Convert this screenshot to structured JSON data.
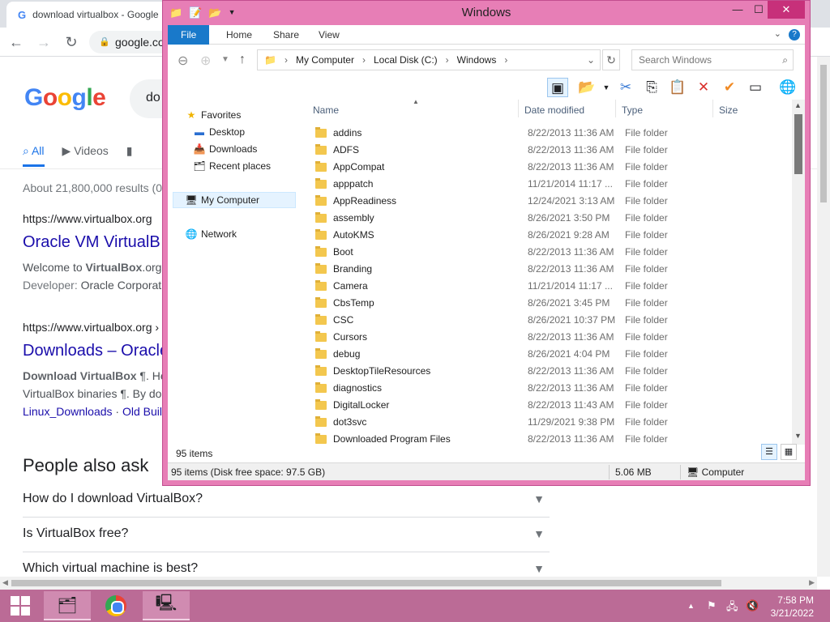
{
  "chrome": {
    "tab_title": "download virtualbox - Google",
    "url": "google.co",
    "logo_letters": [
      "G",
      "o",
      "o",
      "g",
      "l",
      "e"
    ],
    "search_query": "do",
    "search_tabs": [
      {
        "label": "All",
        "icon": "search-icon"
      },
      {
        "label": "Videos",
        "icon": "video-icon"
      },
      {
        "label": "",
        "icon": "book-icon"
      }
    ],
    "results_count": "About 21,800,000 results (0",
    "results": [
      {
        "url": "https://www.virtualbox.org",
        "title": "Oracle VM VirtualB",
        "snippet_prefix": "Welcome to ",
        "snippet_bold": "VirtualBox",
        "snippet_suffix": ".org!",
        "developer_label": "Developer: ",
        "developer": "Oracle Corporat"
      },
      {
        "url": "https://www.virtualbox.org ›",
        "title": "Downloads – Oracle",
        "snippet_bold": "Download VirtualBox",
        "snippet_suffix": " ¶. Her",
        "line2": "VirtualBox binaries ¶. By do",
        "link1": "Linux_Downloads",
        "dot": " · ",
        "link2": "Old Buil"
      }
    ],
    "paa_title": "People also ask",
    "paa": [
      "How do I download VirtualBox?",
      "Is VirtualBox free?",
      "Which virtual machine is best?"
    ]
  },
  "explorer": {
    "title": "Windows",
    "ribbon_tabs": [
      "File",
      "Home",
      "Share",
      "View"
    ],
    "breadcrumb": [
      "My Computer",
      "Local Disk (C:)",
      "Windows"
    ],
    "search_placeholder": "Search Windows",
    "nav": {
      "favorites": "Favorites",
      "desktop": "Desktop",
      "downloads": "Downloads",
      "recent": "Recent places",
      "computer": "My Computer",
      "network": "Network"
    },
    "columns": {
      "name": "Name",
      "date": "Date modified",
      "type": "Type",
      "size": "Size"
    },
    "files": [
      {
        "name": "addins",
        "date": "8/22/2013 11:36 AM",
        "type": "File folder"
      },
      {
        "name": "ADFS",
        "date": "8/22/2013 11:36 AM",
        "type": "File folder"
      },
      {
        "name": "AppCompat",
        "date": "8/22/2013 11:36 AM",
        "type": "File folder"
      },
      {
        "name": "apppatch",
        "date": "11/21/2014 11:17 ...",
        "type": "File folder"
      },
      {
        "name": "AppReadiness",
        "date": "12/24/2021 3:13 AM",
        "type": "File folder"
      },
      {
        "name": "assembly",
        "date": "8/26/2021 3:50 PM",
        "type": "File folder"
      },
      {
        "name": "AutoKMS",
        "date": "8/26/2021 9:28 AM",
        "type": "File folder"
      },
      {
        "name": "Boot",
        "date": "8/22/2013 11:36 AM",
        "type": "File folder"
      },
      {
        "name": "Branding",
        "date": "8/22/2013 11:36 AM",
        "type": "File folder"
      },
      {
        "name": "Camera",
        "date": "11/21/2014 11:17 ...",
        "type": "File folder"
      },
      {
        "name": "CbsTemp",
        "date": "8/26/2021 3:45 PM",
        "type": "File folder"
      },
      {
        "name": "CSC",
        "date": "8/26/2021 10:37 PM",
        "type": "File folder"
      },
      {
        "name": "Cursors",
        "date": "8/22/2013 11:36 AM",
        "type": "File folder"
      },
      {
        "name": "debug",
        "date": "8/26/2021 4:04 PM",
        "type": "File folder"
      },
      {
        "name": "DesktopTileResources",
        "date": "8/22/2013 11:36 AM",
        "type": "File folder"
      },
      {
        "name": "diagnostics",
        "date": "8/22/2013 11:36 AM",
        "type": "File folder"
      },
      {
        "name": "DigitalLocker",
        "date": "8/22/2013 11:43 AM",
        "type": "File folder"
      },
      {
        "name": "dot3svc",
        "date": "11/29/2021 9:38 PM",
        "type": "File folder"
      },
      {
        "name": "Downloaded Program Files",
        "date": "8/22/2013 11:36 AM",
        "type": "File folder"
      }
    ],
    "item_count": "95 items",
    "status": {
      "items": "95 items (Disk free space: 97.5 GB)",
      "size": "5.06 MB",
      "location": "Computer"
    }
  },
  "taskbar": {
    "time": "7:58 PM",
    "date": "3/21/2022"
  },
  "colors": {
    "window_frame": "#e77eb6",
    "taskbar": "#bb6b96",
    "file_tab": "#1979ca",
    "link": "#1a0dab"
  }
}
